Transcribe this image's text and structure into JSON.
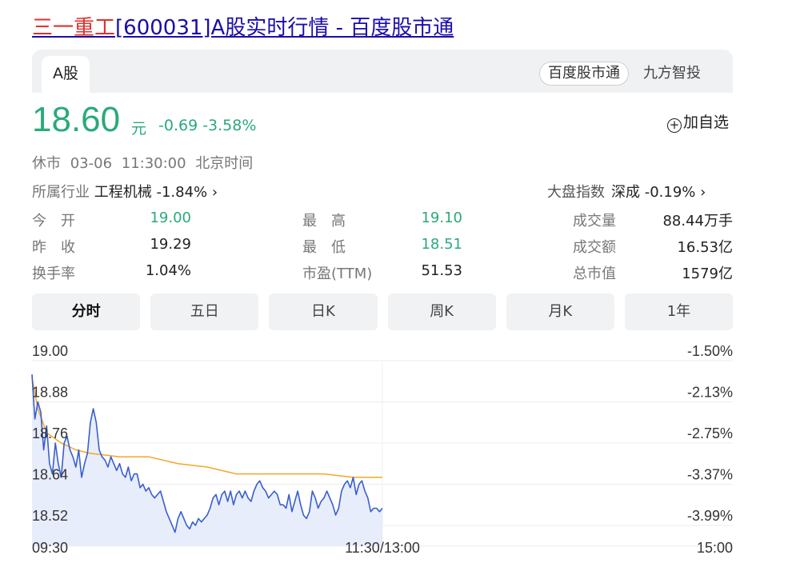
{
  "page": {
    "title_highlight": "三一重工",
    "title_rest": "[600031]A股实时行情 - 百度股市通"
  },
  "tabs": {
    "active": "A股"
  },
  "sources": {
    "primary": "百度股市通",
    "secondary": "九方智投"
  },
  "quote": {
    "price": "18.60",
    "unit": "元",
    "change": "-0.69 -3.58%",
    "add_label": "加自选",
    "status": "休市 03-06 11:30:00 北京时间"
  },
  "industry": {
    "label": "所属行业",
    "value": "工程机械 -1.84% ›"
  },
  "market": {
    "label": "大盘指数",
    "value": "深成 -0.19% ›"
  },
  "stats": [
    {
      "l1": "今　开",
      "v1": "19.00",
      "l2": "最　高",
      "v2": "19.10",
      "l3": "成交量",
      "v3": "88.44万手"
    },
    {
      "l1": "昨　收",
      "v1": "19.29",
      "l2": "最　低",
      "v2": "18.51",
      "l3": "成交额",
      "v3": "16.53亿"
    },
    {
      "l1": "换手率",
      "v1": "1.04%",
      "l2": "市盈(TTM)",
      "v2": "51.53",
      "l3": "总市值",
      "v3": "1579亿"
    }
  ],
  "periods": [
    "分时",
    "五日",
    "日K",
    "周K",
    "月K",
    "1年"
  ],
  "colors": {
    "down": "#2aaa79",
    "price_line": "#3a5fcd",
    "avg_line": "#f5a623",
    "area": "#e8edfb"
  },
  "chart_data": {
    "type": "line",
    "y_ticks": [
      "19.00",
      "18.88",
      "18.76",
      "18.64",
      "18.52"
    ],
    "pct_ticks": [
      "-1.50%",
      "-2.13%",
      "-2.75%",
      "-3.37%",
      "-3.99%"
    ],
    "x_ticks": [
      "09:30",
      "11:30/13:00",
      "15:00"
    ],
    "ylim": [
      18.46,
      19.0
    ],
    "total_minutes": 240,
    "series": [
      {
        "key": "price",
        "minutes": [
          0,
          1,
          2,
          3,
          4,
          5,
          6,
          7,
          8,
          9,
          10,
          11,
          12,
          13,
          14,
          15,
          16,
          17,
          18,
          19,
          20,
          21,
          22,
          23,
          24,
          25,
          26,
          27,
          28,
          29,
          30,
          31,
          32,
          33,
          34,
          35,
          36,
          37,
          38,
          39,
          40,
          41,
          42,
          43,
          44,
          45,
          46,
          47,
          48,
          49,
          50,
          51,
          52,
          53,
          54,
          55,
          56,
          57,
          58,
          59,
          60,
          61,
          62,
          63,
          64,
          65,
          66,
          67,
          68,
          69,
          70,
          71,
          72,
          73,
          74,
          75,
          76,
          77,
          78,
          79,
          80,
          81,
          82,
          83,
          84,
          85,
          86,
          87,
          88,
          89,
          90,
          91,
          92,
          93,
          94,
          95,
          96,
          97,
          98,
          99,
          100,
          101,
          102,
          103,
          104,
          105,
          106,
          107,
          108,
          109,
          110,
          111,
          112,
          113,
          114,
          115,
          116,
          117,
          118,
          119,
          120
        ],
        "values": [
          18.96,
          18.83,
          18.88,
          18.85,
          18.74,
          18.81,
          18.7,
          18.67,
          18.76,
          18.7,
          18.66,
          18.76,
          18.78,
          18.74,
          18.72,
          18.69,
          18.74,
          18.66,
          18.7,
          18.73,
          18.82,
          18.86,
          18.82,
          18.74,
          18.72,
          18.71,
          18.69,
          18.72,
          18.7,
          18.68,
          18.7,
          18.67,
          18.66,
          18.69,
          18.65,
          18.67,
          18.67,
          18.63,
          18.64,
          18.62,
          18.63,
          18.61,
          18.6,
          18.61,
          18.62,
          18.59,
          18.56,
          18.54,
          18.52,
          18.5,
          18.54,
          18.56,
          18.54,
          18.52,
          18.51,
          18.53,
          18.52,
          18.54,
          18.53,
          18.54,
          18.55,
          18.57,
          18.6,
          18.61,
          18.58,
          18.61,
          18.62,
          18.59,
          18.62,
          18.58,
          18.61,
          18.62,
          18.6,
          18.62,
          18.6,
          18.59,
          18.62,
          18.64,
          18.65,
          18.63,
          18.62,
          18.6,
          18.61,
          18.62,
          18.61,
          18.58,
          18.58,
          18.57,
          18.61,
          18.56,
          18.59,
          18.62,
          18.58,
          18.55,
          18.54,
          18.56,
          18.62,
          18.6,
          18.57,
          18.59,
          18.6,
          18.62,
          18.6,
          18.58,
          18.55,
          18.57,
          18.62,
          18.64,
          18.65,
          18.63,
          18.66,
          18.61,
          18.64,
          18.65,
          18.62,
          18.6,
          18.56,
          18.57,
          18.57,
          18.56,
          18.57
        ]
      },
      {
        "key": "avg",
        "minutes": [
          0,
          2,
          5,
          10,
          15,
          20,
          30,
          40,
          50,
          60,
          70,
          80,
          90,
          100,
          110,
          120
        ],
        "values": [
          18.95,
          18.86,
          18.79,
          18.76,
          18.74,
          18.73,
          18.72,
          18.72,
          18.7,
          18.69,
          18.67,
          18.67,
          18.67,
          18.67,
          18.66,
          18.66
        ]
      }
    ]
  }
}
